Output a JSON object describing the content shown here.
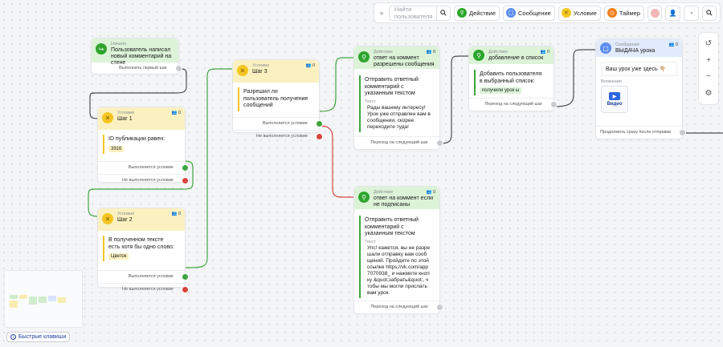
{
  "toolbar": {
    "search_placeholder": "Найти пользователя",
    "action_label": "Действие",
    "message_label": "Сообщение",
    "condition_label": "Условие",
    "timer_label": "Таймер"
  },
  "colors": {
    "action": "#2ea52e",
    "condition": "#f5c623",
    "message": "#5b8def",
    "timer": "#f07d1a",
    "yes": "#3da53d",
    "no": "#d9443a"
  },
  "shortcuts_label": "Быстрые клавиши",
  "nodes": {
    "start": {
      "type": "Начало",
      "title": "Пользователь написал новый комментарий на стене",
      "out": "Выполнить первый шаг"
    },
    "step1": {
      "type": "Условие",
      "title": "Шаг 1",
      "count": "0",
      "block": "ID публикации равен:",
      "tag": "3916",
      "yes": "Выполняется условие",
      "no": "Не выполняется условие"
    },
    "step2": {
      "type": "Условие",
      "title": "Шаг 2",
      "count": "0",
      "block": "В полученном тексте есть хотя бы одно слово:",
      "tag": "Цветок",
      "yes": "Выполняется условие",
      "no": "Не выполняется условие"
    },
    "step3": {
      "type": "Условие",
      "title": "Шаг 3",
      "count": "0",
      "block": "Разрешил ли пользователь получение сообщений",
      "yes": "Выполняется условие",
      "no": "Не выполняется условие"
    },
    "act1": {
      "type": "Действие",
      "title": "ответ на коммент разрешены сообщения",
      "count": "0",
      "block": "Отправить ответный комментарий с указанным текстом",
      "sub": "Текст",
      "text": "Рады вашему интересу! Урок уже отправлен вам в сообщении, скорее переходите туда!",
      "out": "Переход на следующий шаг"
    },
    "act2": {
      "type": "Действие",
      "title": "добавление в список",
      "count": "0",
      "block": "Добавить пользователя в выбранный список:",
      "tag": "получили урок ы",
      "out": "Переход на следующий шаг"
    },
    "act3": {
      "type": "Действие",
      "title": "ответ на коммент если не подписаны",
      "count": "0",
      "block": "Отправить ответный комментарий с указанным текстом",
      "sub": "Текст",
      "text": "Упс! кажется, вы не разрешали отправку вам сообщений. Пройдите по этой ссылке https://vk.com/app7070938_ и нажмите кнопку &quot;забрать&quot;, чтобы мы могли прислать вам урок.",
      "out": "Переход на следующий шаг"
    },
    "msg1": {
      "type": "Сообщение",
      "title": "ВЫДАЧА урока",
      "count": "0",
      "message": "Ваш урок уже здесь 👇🏼",
      "attach_label": "Вложения",
      "video_label": "Видео",
      "out": "Продолжить сразу после отправки"
    }
  }
}
